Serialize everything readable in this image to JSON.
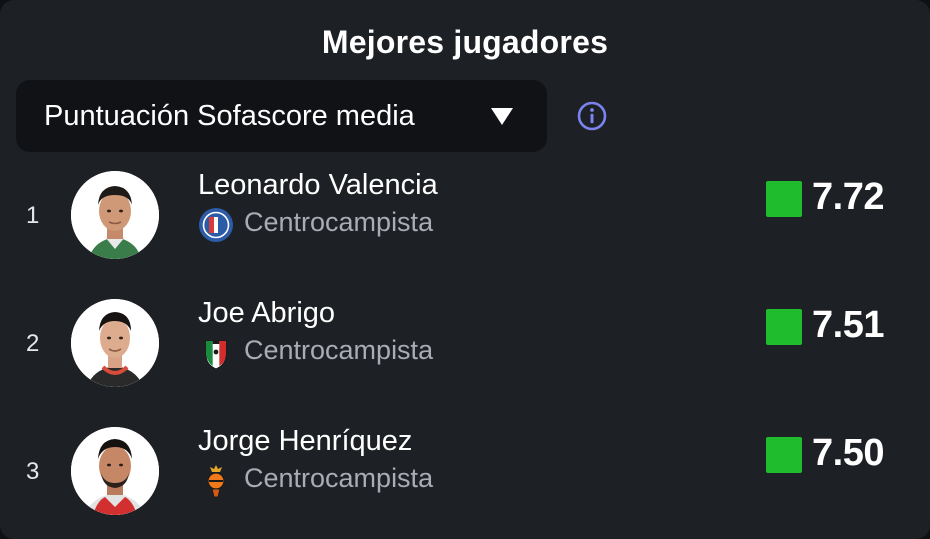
{
  "header": {
    "title": "Mejores jugadores"
  },
  "filter": {
    "selected": "Puntuación Sofascore media",
    "icon": "caret-down-icon",
    "info_icon": "info-icon"
  },
  "colors": {
    "background": "#1d2024",
    "dropdown_bg": "#101215",
    "rating_good": "#1fbd2d",
    "info_accent": "#7b83f0"
  },
  "players": [
    {
      "rank": "1",
      "name": "Leonardo Valencia",
      "position": "Centrocampista",
      "team_icon": "club-crest-blue-icon",
      "rating": "7.72"
    },
    {
      "rank": "2",
      "name": "Joe Abrigo",
      "position": "Centrocampista",
      "team_icon": "club-crest-tricolor-icon",
      "rating": "7.51"
    },
    {
      "rank": "3",
      "name": "Jorge Henríquez",
      "position": "Centrocampista",
      "team_icon": "club-crest-orange-icon",
      "rating": "7.50"
    }
  ]
}
